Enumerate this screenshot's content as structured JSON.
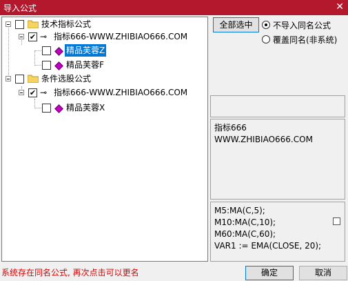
{
  "window": {
    "title": "导入公式",
    "close_glyph": "✕"
  },
  "tree": {
    "groups": [
      {
        "label": "技术指标公式",
        "source": {
          "label": "指标666-WWW.ZHIBIAO666.COM",
          "checked": true
        },
        "items": [
          {
            "label": "精品芙蓉Z",
            "selected": true,
            "checked": false
          },
          {
            "label": "精品芙蓉F",
            "selected": false,
            "checked": false
          }
        ]
      },
      {
        "label": "条件选股公式",
        "source": {
          "label": "指标666-WWW.ZHIBIAO666.COM",
          "checked": true
        },
        "items": [
          {
            "label": "精品芙蓉X",
            "selected": false,
            "checked": false
          }
        ]
      }
    ],
    "check_glyph": "✔"
  },
  "controls": {
    "select_all_label": "全部选中",
    "radio_options": [
      {
        "label": "不导入同名公式",
        "selected": true
      },
      {
        "label": "覆盖同名(非系统)",
        "selected": false
      }
    ]
  },
  "info_panel": {
    "lines": [
      "指标666",
      "WWW.ZHIBIAO666.COM"
    ]
  },
  "code_panel": {
    "lines": [
      "M5:MA(C,5);",
      "M10:MA(C,10);",
      "M60:MA(C,60);",
      "VAR1 := EMA(CLOSE, 20);"
    ]
  },
  "status_text": "系统存在同名公式, 再次点击可以更名",
  "buttons": {
    "ok_label": "确定",
    "cancel_label": "取消"
  },
  "colors": {
    "titlebar": "#b3182c",
    "selection": "#0078d7",
    "status": "#e00000",
    "gem": "#c000c0",
    "folder": "#f4d35e"
  }
}
